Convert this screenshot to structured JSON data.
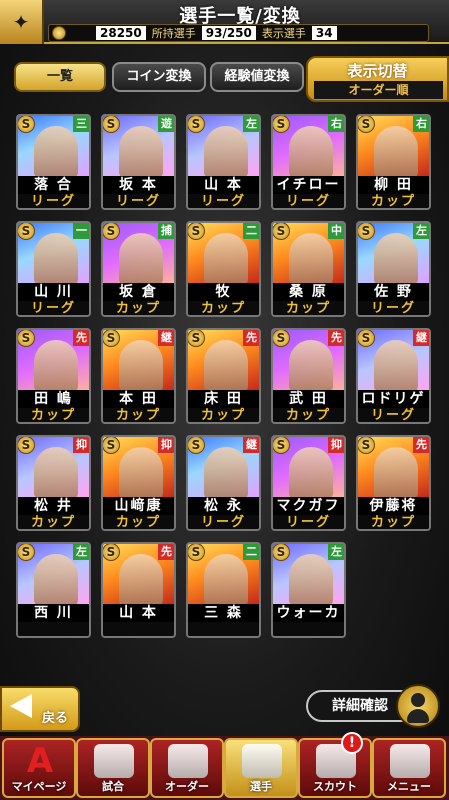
{
  "header": {
    "title": "選手一覧/変換",
    "coins": "28250",
    "owned_label": "所持選手",
    "owned_value": "93/250",
    "display_label": "表示選手",
    "display_value": "34"
  },
  "tabs": [
    {
      "label": "一覧",
      "active": true
    },
    {
      "label": "コイン変換",
      "active": false
    },
    {
      "label": "経験値変換",
      "active": false
    }
  ],
  "toggle": {
    "title": "表示切替",
    "value": "オーダー順"
  },
  "cards": [
    {
      "name": "落 合",
      "type": "リーグ",
      "pos": "三",
      "pos_color": "green",
      "art": "blue"
    },
    {
      "name": "坂 本",
      "type": "リーグ",
      "pos": "遊",
      "pos_color": "green",
      "art": "ice"
    },
    {
      "name": "山 本",
      "type": "リーグ",
      "pos": "左",
      "pos_color": "green",
      "art": "ice"
    },
    {
      "name": "イチロー",
      "type": "リーグ",
      "pos": "右",
      "pos_color": "green",
      "art": "purple"
    },
    {
      "name": "柳 田",
      "type": "カップ",
      "pos": "右",
      "pos_color": "green",
      "art": "fire"
    },
    {
      "name": "山 川",
      "type": "リーグ",
      "pos": "一",
      "pos_color": "green",
      "art": "blue"
    },
    {
      "name": "坂 倉",
      "type": "カップ",
      "pos": "捕",
      "pos_color": "green",
      "art": "purple"
    },
    {
      "name": "牧",
      "type": "カップ",
      "pos": "二",
      "pos_color": "green",
      "art": "fire"
    },
    {
      "name": "桑 原",
      "type": "カップ",
      "pos": "中",
      "pos_color": "green",
      "art": "fire"
    },
    {
      "name": "佐 野",
      "type": "リーグ",
      "pos": "左",
      "pos_color": "green",
      "art": "blue"
    },
    {
      "name": "田 嶋",
      "type": "カップ",
      "pos": "先",
      "pos_color": "red",
      "art": "purple"
    },
    {
      "name": "本 田",
      "type": "カップ",
      "pos": "継",
      "pos_color": "red",
      "art": "fire"
    },
    {
      "name": "床 田",
      "type": "カップ",
      "pos": "先",
      "pos_color": "red",
      "art": "fire"
    },
    {
      "name": "武 田",
      "type": "カップ",
      "pos": "先",
      "pos_color": "red",
      "art": "purple"
    },
    {
      "name": "ロドリゲス",
      "type": "リーグ",
      "pos": "継",
      "pos_color": "red",
      "art": "ice"
    },
    {
      "name": "松 井",
      "type": "カップ",
      "pos": "抑",
      "pos_color": "red",
      "art": "ice"
    },
    {
      "name": "山﨑康",
      "type": "カップ",
      "pos": "抑",
      "pos_color": "red",
      "art": "fire"
    },
    {
      "name": "松 永",
      "type": "リーグ",
      "pos": "継",
      "pos_color": "red",
      "art": "blue"
    },
    {
      "name": "マクガフ",
      "type": "リーグ",
      "pos": "抑",
      "pos_color": "red",
      "art": "purple"
    },
    {
      "name": "伊藤将",
      "type": "カップ",
      "pos": "先",
      "pos_color": "red",
      "art": "fire"
    },
    {
      "name": "西 川",
      "type": "",
      "pos": "左",
      "pos_color": "green",
      "art": "ice"
    },
    {
      "name": "山 本",
      "type": "",
      "pos": "先",
      "pos_color": "red",
      "art": "fire"
    },
    {
      "name": "三 森",
      "type": "",
      "pos": "二",
      "pos_color": "green",
      "art": "fire"
    },
    {
      "name": "ウォーカー",
      "type": "",
      "pos": "左",
      "pos_color": "green",
      "art": "ice"
    }
  ],
  "card_badge": "S",
  "controls": {
    "back_label": "戻る",
    "detail_label": "詳細確認"
  },
  "nav": [
    {
      "label": "マイページ",
      "icon": "a-icon",
      "glyph": "A",
      "active": false
    },
    {
      "label": "試合",
      "icon": "field-icon",
      "active": false
    },
    {
      "label": "オーダー",
      "icon": "order-icon",
      "active": false
    },
    {
      "label": "選手",
      "icon": "player-icon",
      "active": true
    },
    {
      "label": "スカウト",
      "icon": "scout-icon",
      "active": false
    },
    {
      "label": "メニュー",
      "icon": "menu-icon",
      "active": false
    }
  ],
  "notification": "!"
}
